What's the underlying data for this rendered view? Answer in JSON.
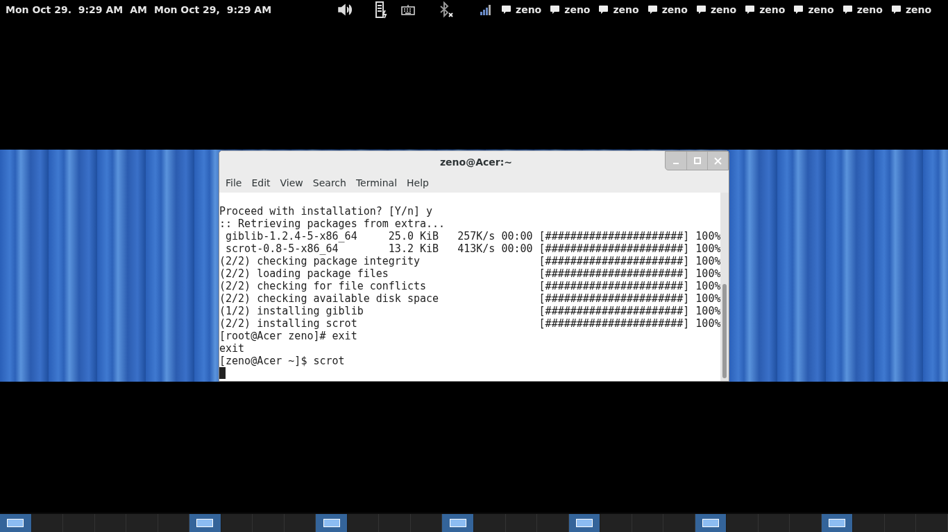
{
  "top_panel": {
    "clocks": [
      "Mon Oct 29.  9:29 AM",
      "AM",
      "Mon Oct 29,  9:29 AM"
    ],
    "chat_items": [
      {
        "label": "zeno"
      },
      {
        "label": "zeno"
      },
      {
        "label": "zeno"
      },
      {
        "label": "zeno"
      },
      {
        "label": "zeno"
      },
      {
        "label": "zeno"
      },
      {
        "label": "zeno"
      },
      {
        "label": "zeno"
      },
      {
        "label": "zeno"
      }
    ]
  },
  "window": {
    "title": "zeno@Acer:~",
    "menu": [
      "File",
      "Edit",
      "View",
      "Search",
      "Terminal",
      "Help"
    ],
    "lines": [
      "Proceed with installation? [Y/n] y",
      ":: Retrieving packages from extra...",
      " giblib-1.2.4-5-x86_64     25.0 KiB   257K/s 00:00 [######################] 100%",
      " scrot-0.8-5-x86_64        13.2 KiB   413K/s 00:00 [######################] 100%",
      "(2/2) checking package integrity                   [######################] 100%",
      "(2/2) loading package files                        [######################] 100%",
      "(2/2) checking for file conflicts                  [######################] 100%",
      "(2/2) checking available disk space                [######################] 100%",
      "(1/2) installing giblib                            [######################] 100%",
      "(2/2) installing scrot                             [######################] 100%",
      "[root@Acer zeno]# exit",
      "exit",
      "[zeno@Acer ~]$ scrot"
    ]
  },
  "workspaces": [
    {
      "selected": true
    },
    {
      "selected": false
    },
    {
      "selected": false
    },
    {
      "selected": false
    },
    {
      "selected": false
    },
    {
      "selected": false
    },
    {
      "selected": true
    },
    {
      "selected": false
    },
    {
      "selected": false
    },
    {
      "selected": false
    },
    {
      "selected": true
    },
    {
      "selected": false
    },
    {
      "selected": false
    },
    {
      "selected": false
    },
    {
      "selected": true
    },
    {
      "selected": false
    },
    {
      "selected": false
    },
    {
      "selected": false
    },
    {
      "selected": true
    },
    {
      "selected": false
    },
    {
      "selected": false
    },
    {
      "selected": false
    },
    {
      "selected": true
    },
    {
      "selected": false
    },
    {
      "selected": false
    },
    {
      "selected": false
    },
    {
      "selected": true
    },
    {
      "selected": false
    },
    {
      "selected": false
    },
    {
      "selected": false
    }
  ]
}
